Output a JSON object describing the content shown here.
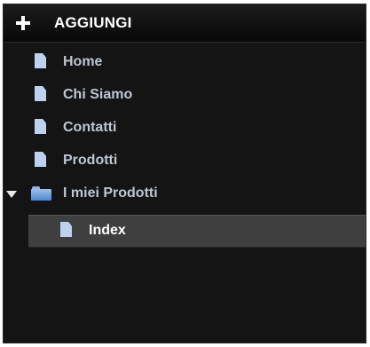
{
  "header": {
    "add_label": "AGGIUNGI",
    "icon": "plus-icon"
  },
  "tree": {
    "items": [
      {
        "label": "Home",
        "icon": "document-icon"
      },
      {
        "label": "Chi Siamo",
        "icon": "document-icon"
      },
      {
        "label": "Contatti",
        "icon": "document-icon"
      },
      {
        "label": "Prodotti",
        "icon": "document-icon"
      },
      {
        "label": "I miei Prodotti",
        "icon": "folder-icon",
        "expanded": true,
        "children": [
          {
            "label": "Index",
            "icon": "document-icon",
            "selected": true
          }
        ]
      }
    ]
  },
  "colors": {
    "background": "#141414",
    "selected_row": "#3f3f3f",
    "label_text": "#bfc6d2",
    "icon_blue": "#bcd2ee"
  }
}
